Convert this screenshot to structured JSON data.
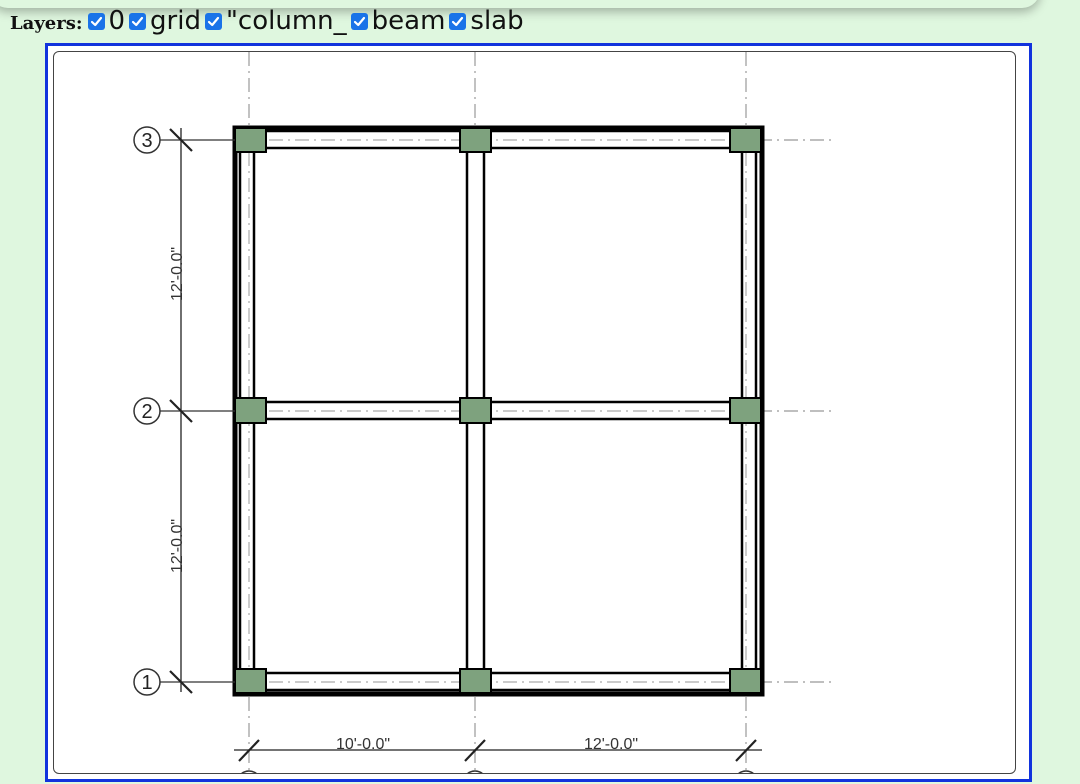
{
  "layers_bar": {
    "title": "Layers:",
    "items": [
      {
        "label": "0",
        "checked": true
      },
      {
        "label": "grid",
        "checked": true
      },
      {
        "label": "\"column_",
        "checked": true
      },
      {
        "label": "beam",
        "checked": true
      },
      {
        "label": "slab",
        "checked": true
      }
    ]
  },
  "drawing": {
    "grid_labels": [
      "3",
      "2",
      "1"
    ],
    "dim_vertical_upper": "12'-0.0\"",
    "dim_vertical_lower": "12'-0.0\"",
    "dim_horizontal_left": "10'-0.0\"",
    "dim_horizontal_right": "12'-0.0\""
  },
  "colors": {
    "background": "#dff7df",
    "viewer_border": "#1133dd",
    "checkbox": "#1a73e8",
    "column_fill": "#7ea27e"
  }
}
